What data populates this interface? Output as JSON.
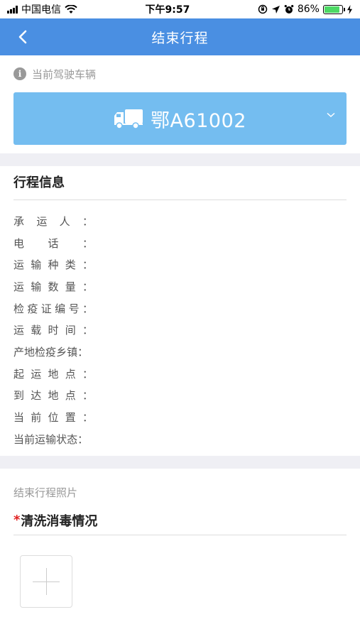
{
  "status_bar": {
    "carrier": "中国电信",
    "time": "下午9:57",
    "battery_percent": "86%",
    "battery_level": 0.86,
    "icons": [
      "signal-icon",
      "wifi-icon",
      "orientation-lock-icon",
      "location-icon",
      "alarm-icon",
      "battery-icon",
      "charging-icon"
    ]
  },
  "nav": {
    "title": "结束行程",
    "back_icon": "chevron-left-icon"
  },
  "vehicle": {
    "hint": "当前驾驶车辆",
    "hint_icon": "info-icon",
    "info_glyph": "i",
    "plate": "鄂A61002",
    "truck_icon": "truck-icon",
    "chevron_icon": "chevron-down-icon",
    "select_color": "#74bdf0"
  },
  "trip_info": {
    "title": "行程信息",
    "fields": [
      {
        "label": "承运人",
        "suffix": "：",
        "value": ""
      },
      {
        "label": "电话",
        "suffix": "：",
        "value": ""
      },
      {
        "label": "运输种类",
        "suffix": "：",
        "value": ""
      },
      {
        "label": "运输数量",
        "suffix": "：",
        "value": ""
      },
      {
        "label": "检疫证编号",
        "suffix": "：",
        "value": ""
      },
      {
        "label": "运载时间",
        "suffix": "：",
        "value": ""
      },
      {
        "label": "产地检疫乡镇",
        "suffix": "：",
        "value": ""
      },
      {
        "label": "起运地点",
        "suffix": "：",
        "value": ""
      },
      {
        "label": "到达地点",
        "suffix": "：",
        "value": ""
      },
      {
        "label": "当前位置",
        "suffix": "：",
        "value": ""
      },
      {
        "label": "当前运输状态",
        "suffix": "：",
        "value": ""
      }
    ]
  },
  "photos": {
    "hint": "结束行程照片",
    "required_mark": "*",
    "title": "清洗消毒情况",
    "upload_icon": "plus-icon"
  },
  "colors": {
    "nav_bar": "#4a8fe2",
    "required": "#e02020",
    "battery": "#4cd964"
  }
}
